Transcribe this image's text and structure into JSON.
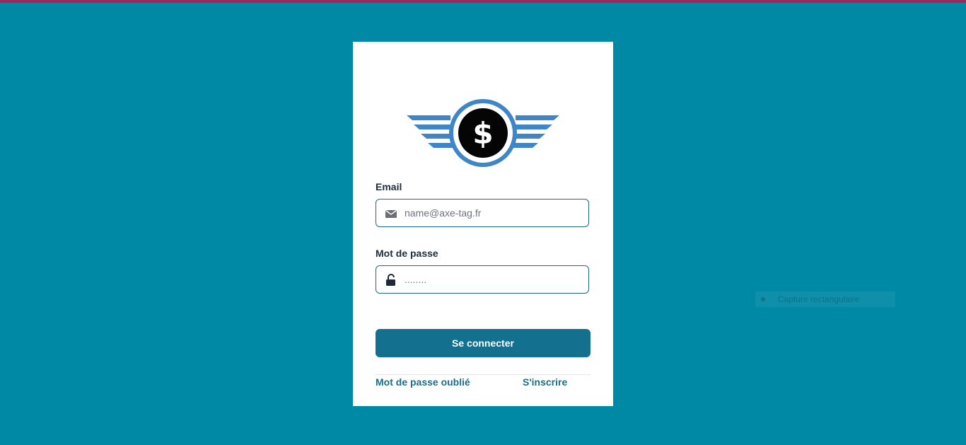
{
  "colors": {
    "background": "#0089a4",
    "top_strip": "#a0275a",
    "primary_button": "#13718f",
    "link": "#1d6d86",
    "logo_blue": "#3f86c8"
  },
  "logo": {
    "symbol": "$",
    "icon": "winged-dollar-logo"
  },
  "form": {
    "email_label": "Email",
    "email_placeholder": "name@axe-tag.fr",
    "email_value": "",
    "email_icon": "envelope-icon",
    "password_label": "Mot de passe",
    "password_value": "........",
    "password_icon": "unlock-icon",
    "submit_label": "Se connecter"
  },
  "links": {
    "forgot_password": "Mot de passe oublié",
    "register": "S'inscrire"
  },
  "overlay": {
    "text": "Capture rectangulaire"
  }
}
